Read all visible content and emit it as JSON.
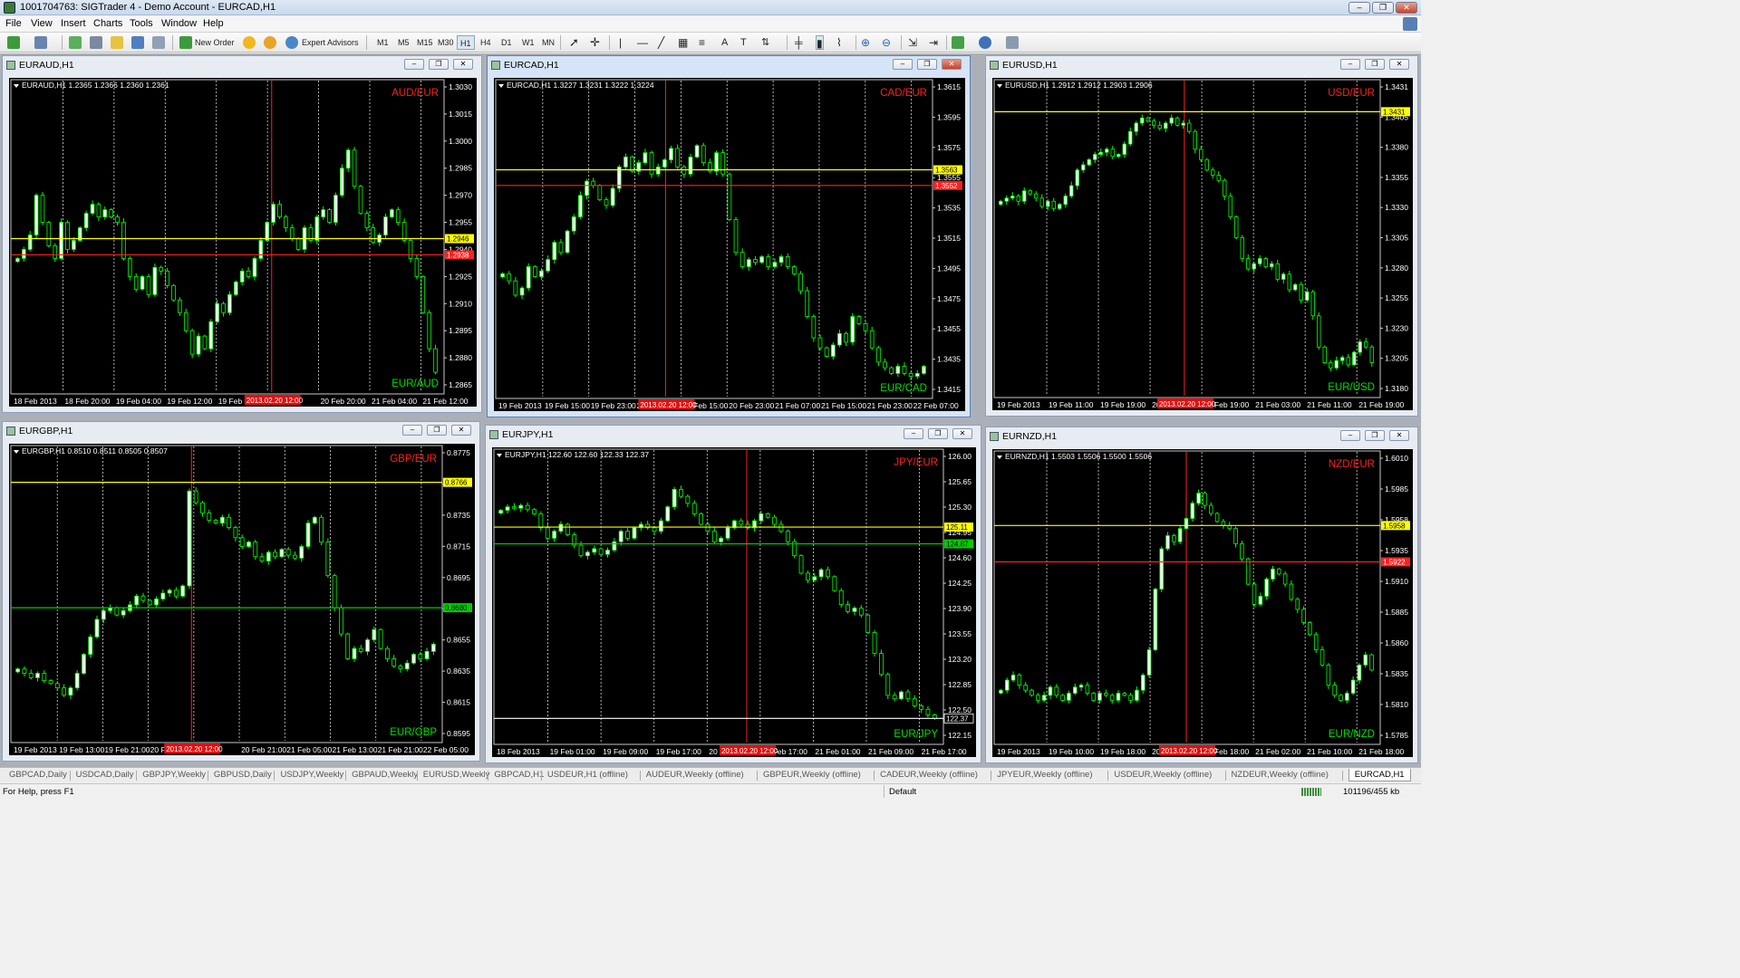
{
  "window": {
    "title": "1001704763: SIGTrader 4 - Demo Account - EURCAD,H1"
  },
  "menu": [
    "File",
    "View",
    "Insert",
    "Charts",
    "Tools",
    "Window",
    "Help"
  ],
  "toolbar": {
    "new_order": "New Order",
    "expert_advisors": "Expert Advisors",
    "timeframes": [
      "M1",
      "M5",
      "M15",
      "M30",
      "H1",
      "H4",
      "D1",
      "W1",
      "MN"
    ],
    "active_timeframe": "H1"
  },
  "colors": {
    "bull": "#ffffff",
    "bear": "#000000",
    "candle_border": "#00ff00",
    "grid": "#d8d8d8",
    "hline_yellow": "#ffff00",
    "hline_red": "#ff2020",
    "hline_green": "#00cc00",
    "label_red": "#ff2020",
    "label_green": "#00e000"
  },
  "charts": [
    {
      "window_title": "EURAUD,H1",
      "info": "EURAUD,H1  1.2365 1.2366 1.2360 1.2361",
      "top_label": "AUD/EUR",
      "bottom_label": "EUR/AUD",
      "price_ticks": [
        "1.3030",
        "1.3015",
        "1.3000",
        "1.2985",
        "1.2970",
        "1.2955",
        "1.2940",
        "1.2925",
        "1.2910",
        "1.2895",
        "1.2880",
        "1.2865"
      ],
      "time_ticks": [
        "18 Feb 2013",
        "18 Feb 20:00",
        "19 Feb 04:00",
        "19 Feb 12:00",
        "19 Feb 20:00",
        "20 Fe",
        "20 Feb 20:00",
        "21 Feb 04:00",
        "21 Feb 12:00"
      ],
      "ymin": 1.2862,
      "ymax": 1.3033,
      "hlines": [
        {
          "price": 1.2946,
          "color": "yellow",
          "label": "1.2946"
        },
        {
          "price": 1.2937,
          "color": "red",
          "label": "1.2938"
        }
      ],
      "vline_frac": 0.605,
      "vline_label": "2013.02.20 12:00",
      "closes": [
        1.2935,
        1.294,
        1.2948,
        1.297,
        1.2955,
        1.2942,
        1.2935,
        1.2955,
        1.294,
        1.2945,
        1.2952,
        1.296,
        1.2965,
        1.2958,
        1.2962,
        1.2958,
        1.2955,
        1.2935,
        1.2925,
        1.2918,
        1.2925,
        1.2915,
        1.293,
        1.2928,
        1.292,
        1.2912,
        1.2905,
        1.2895,
        1.2882,
        1.2892,
        1.2885,
        1.29,
        1.291,
        1.2905,
        1.2915,
        1.2922,
        1.2928,
        1.2925,
        1.2935,
        1.2945,
        1.2955,
        1.2965,
        1.2958,
        1.2952,
        1.2946,
        1.294,
        1.2952,
        1.2945,
        1.2958,
        1.2962,
        1.2955,
        1.297,
        1.2985,
        1.2995,
        1.2975,
        1.296,
        1.2952,
        1.2944,
        1.2948,
        1.2958,
        1.2962,
        1.2955,
        1.2945,
        1.2935,
        1.2925,
        1.2905,
        1.2885,
        1.2872
      ]
    },
    {
      "window_title": "EURCAD,H1",
      "info": "EURCAD,H1  1.3227 1.3231 1.3222 1.3224",
      "top_label": "CAD/EUR",
      "bottom_label": "EUR/CAD",
      "price_ticks": [
        "1.3615",
        "1.3595",
        "1.3575",
        "1.3555",
        "1.3535",
        "1.3515",
        "1.3495",
        "1.3475",
        "1.3455",
        "1.3435",
        "1.3415"
      ],
      "time_ticks": [
        "19 Feb 2013",
        "19 Feb 15:00",
        "19 Feb 23:00",
        "20 Feb 07:00",
        "20 Feb 15:00",
        "20 Feb 23:00",
        "21 Feb 07:00",
        "21 Feb 15:00",
        "21 Feb 23:00",
        "22 Feb 07:00"
      ],
      "ymin": 1.3405,
      "ymax": 1.3625,
      "hlines": [
        {
          "price": 1.3563,
          "color": "yellow",
          "label": "1.3563"
        },
        {
          "price": 1.3552,
          "color": "red",
          "label": "1.3552"
        }
      ],
      "vline_frac": 0.39,
      "vline_label": "2013.02.20 12:00",
      "closes": [
        1.349,
        1.3485,
        1.3475,
        1.348,
        1.3495,
        1.3488,
        1.3492,
        1.35,
        1.3512,
        1.3505,
        1.352,
        1.353,
        1.3545,
        1.3555,
        1.3552,
        1.3542,
        1.3538,
        1.355,
        1.3565,
        1.3572,
        1.3562,
        1.3568,
        1.3575,
        1.356,
        1.3565,
        1.357,
        1.3578,
        1.3565,
        1.356,
        1.3572,
        1.358,
        1.3568,
        1.3562,
        1.3575,
        1.356,
        1.3528,
        1.3505,
        1.3495,
        1.35,
        1.3498,
        1.3502,
        1.3495,
        1.3498,
        1.3502,
        1.3495,
        1.349,
        1.3478,
        1.346,
        1.3445,
        1.3438,
        1.3432,
        1.344,
        1.3448,
        1.3442,
        1.346,
        1.3455,
        1.345,
        1.3438,
        1.3428,
        1.3424,
        1.342,
        1.3425,
        1.342,
        1.3418,
        1.342,
        1.3425
      ]
    },
    {
      "window_title": "EURUSD,H1",
      "info": "EURUSD,H1  1.2912 1.2912 1.2903 1.2906",
      "top_label": "USD/EUR",
      "bottom_label": "EUR/USD",
      "price_ticks": [
        "1.3431",
        "1.3405",
        "1.3380",
        "1.3355",
        "1.3330",
        "1.3305",
        "1.3280",
        "1.3255",
        "1.3230",
        "1.3205",
        "1.3180"
      ],
      "time_ticks": [
        "19 Feb 2013",
        "19 Feb 11:00",
        "19 Feb 19:00",
        "20 Feb",
        "20 Feb 19:00",
        "21 Feb 03:00",
        "21 Feb 11:00",
        "21 Feb 19:00"
      ],
      "ymin": 1.316,
      "ymax": 1.346,
      "hlines": [
        {
          "price": 1.3431,
          "color": "yellow",
          "label": "1.3431"
        }
      ],
      "vline_frac": 0.495,
      "vline_label": "2013.02.20 12:00",
      "closes": [
        1.3345,
        1.3348,
        1.335,
        1.3345,
        1.3355,
        1.3352,
        1.3348,
        1.334,
        1.3345,
        1.3338,
        1.3342,
        1.335,
        1.336,
        1.3375,
        1.338,
        1.3385,
        1.339,
        1.3392,
        1.3395,
        1.3388,
        1.339,
        1.34,
        1.3412,
        1.342,
        1.3425,
        1.3422,
        1.3418,
        1.3415,
        1.342,
        1.3425,
        1.3418,
        1.342,
        1.3412,
        1.3395,
        1.3385,
        1.3375,
        1.337,
        1.3365,
        1.335,
        1.333,
        1.331,
        1.329,
        1.328,
        1.3285,
        1.329,
        1.3282,
        1.3285,
        1.327,
        1.3275,
        1.326,
        1.3265,
        1.325,
        1.3258,
        1.3235,
        1.3205,
        1.319,
        1.3185,
        1.3192,
        1.3195,
        1.3188,
        1.32,
        1.321,
        1.3205,
        1.319
      ]
    },
    {
      "window_title": "EURGBP,H1",
      "info": "EURGBP,H1  0.8510 0.8511 0.8505 0.8507",
      "top_label": "GBP/EUR",
      "bottom_label": "EUR/GBP",
      "price_ticks": [
        "0.8775",
        "0.8755",
        "0.8735",
        "0.8715",
        "0.8695",
        "0.8675",
        "0.8655",
        "0.8635",
        "0.8615",
        "0.8595"
      ],
      "time_ticks": [
        "19 Feb 2013",
        "19 Feb 13:00",
        "19 Feb 21:00",
        "20 F",
        "13:00",
        "20 Feb 21:00",
        "21 Feb 05:00",
        "21 Feb 13:00",
        "21 Feb 21:00",
        "22 Feb 05:00"
      ],
      "ymin": 0.859,
      "ymax": 0.879,
      "hlines": [
        {
          "price": 0.8766,
          "color": "yellow",
          "label": "0.8766"
        },
        {
          "price": 0.868,
          "color": "green",
          "label": "0.8680"
        }
      ],
      "vline_frac": 0.42,
      "vline_label": "2013.02.20 12:00",
      "closes": [
        0.8638,
        0.8635,
        0.8632,
        0.8635,
        0.863,
        0.8628,
        0.8625,
        0.862,
        0.8625,
        0.8635,
        0.8648,
        0.866,
        0.8672,
        0.8678,
        0.868,
        0.8675,
        0.8678,
        0.8682,
        0.8688,
        0.8685,
        0.8682,
        0.8686,
        0.869,
        0.8692,
        0.8688,
        0.8695,
        0.876,
        0.8752,
        0.8745,
        0.874,
        0.8738,
        0.8742,
        0.8735,
        0.8728,
        0.8722,
        0.8725,
        0.8715,
        0.8712,
        0.8718,
        0.8715,
        0.872,
        0.8716,
        0.8714,
        0.8722,
        0.8738,
        0.8742,
        0.8725,
        0.8702,
        0.868,
        0.8662,
        0.8645,
        0.8652,
        0.865,
        0.8658,
        0.8665,
        0.8652,
        0.8645,
        0.864,
        0.8638,
        0.8642,
        0.8648,
        0.8645,
        0.865,
        0.8655
      ]
    },
    {
      "window_title": "EURJPY,H1",
      "info": "EURJPY,H1  122.60 122.60 122.33 122.37",
      "top_label": "JPY/EUR",
      "bottom_label": "EUR/JPY",
      "price_ticks": [
        "126.00",
        "125.65",
        "125.30",
        "124.95",
        "124.60",
        "124.25",
        "123.90",
        "123.55",
        "123.20",
        "122.85",
        "122.50",
        "122.15"
      ],
      "time_ticks": [
        "18 Feb 2013",
        "19 Feb 01:00",
        "19 Feb 09:00",
        "19 Feb 17:00",
        "20 Feb 01:00",
        "20 Feb 17:00",
        "21 Feb 01:00",
        "21 Feb 09:00",
        "21 Feb 17:00"
      ],
      "ymin": 122.05,
      "ymax": 126.2,
      "hlines": [
        {
          "price": 125.11,
          "color": "yellow",
          "label": "125.11"
        },
        {
          "price": 124.87,
          "color": "green",
          "label": "124.87"
        },
        {
          "price": 122.37,
          "color": "white",
          "label": "122.37"
        }
      ],
      "vline_frac": 0.565,
      "vline_label": "2013.02.20 12:00",
      "closes": [
        125.35,
        125.4,
        125.38,
        125.42,
        125.36,
        125.3,
        125.1,
        124.95,
        125.05,
        125.15,
        125.0,
        124.85,
        124.7,
        124.75,
        124.8,
        124.72,
        124.78,
        124.9,
        125.05,
        124.95,
        125.1,
        125.15,
        125.1,
        125.05,
        125.2,
        125.4,
        125.65,
        125.55,
        125.45,
        125.3,
        125.15,
        125.05,
        124.9,
        124.95,
        125.1,
        125.2,
        125.15,
        125.1,
        125.2,
        125.3,
        125.25,
        125.15,
        125.05,
        124.9,
        124.7,
        124.45,
        124.35,
        124.4,
        124.5,
        124.4,
        124.2,
        124.0,
        123.9,
        123.95,
        123.85,
        123.6,
        123.3,
        123.0,
        122.7,
        122.65,
        122.75,
        122.65,
        122.55,
        122.5,
        122.42,
        122.37
      ]
    },
    {
      "window_title": "EURNZD,H1",
      "info": "EURNZD,H1  1.5503 1.5506 1.5500 1.5506",
      "top_label": "NZD/EUR",
      "bottom_label": "EUR/NZD",
      "price_ticks": [
        "1.6010",
        "1.5985",
        "1.5958",
        "1.5935",
        "1.5910",
        "1.5885",
        "1.5860",
        "1.5835",
        "1.5810",
        "1.5785"
      ],
      "time_ticks": [
        "19 Feb 2013",
        "19 Feb 10:00",
        "19 Feb 18:00",
        "20 Feb 02",
        "20 Feb 18:00",
        "21 Feb 02:00",
        "21 Feb 10:00",
        "21 Feb 18:00"
      ],
      "ymin": 1.5745,
      "ymax": 1.603,
      "hlines": [
        {
          "price": 1.5958,
          "color": "yellow",
          "label": "1.5958"
        },
        {
          "price": 1.5922,
          "color": "red",
          "label": "1.5922"
        }
      ],
      "vline_frac": 0.5,
      "vline_label": "2013.02.20 12:00",
      "closes": [
        1.5795,
        1.5805,
        1.581,
        1.58,
        1.5795,
        1.579,
        1.5785,
        1.579,
        1.5798,
        1.579,
        1.5785,
        1.5792,
        1.5798,
        1.58,
        1.5792,
        1.5785,
        1.5792,
        1.579,
        1.5785,
        1.5792,
        1.579,
        1.5785,
        1.5795,
        1.581,
        1.5835,
        1.5895,
        1.5935,
        1.5948,
        1.5942,
        1.5955,
        1.5965,
        1.598,
        1.599,
        1.5978,
        1.597,
        1.5962,
        1.5958,
        1.5955,
        1.594,
        1.5925,
        1.59,
        1.588,
        1.5888,
        1.5905,
        1.5915,
        1.591,
        1.59,
        1.5885,
        1.5875,
        1.5862,
        1.585,
        1.5835,
        1.582,
        1.58,
        1.579,
        1.5785,
        1.5792,
        1.5805,
        1.582,
        1.583,
        1.5815
      ]
    }
  ],
  "tabs": [
    "GBPCAD,Daily",
    "USDCAD,Daily",
    "GBPJPY,Weekly",
    "GBPUSD,Daily",
    "USDJPY,Weekly",
    "GBPAUD,Weekly",
    "EURUSD,Weekly",
    "GBPCAD,H1",
    "USDEUR,H1 (offline)",
    "AUDEUR,Weekly (offline)",
    "GBPEUR,Weekly (offline)",
    "CADEUR,Weekly (offline)",
    "JPYEUR,Weekly (offline)",
    "USDEUR,Weekly (offline)",
    "NZDEUR,Weekly (offline)",
    "EURCAD,H1"
  ],
  "active_tab": "EURCAD,H1",
  "status": {
    "help": "For Help, press F1",
    "profile": "Default",
    "traffic": "101196/455 kb"
  }
}
